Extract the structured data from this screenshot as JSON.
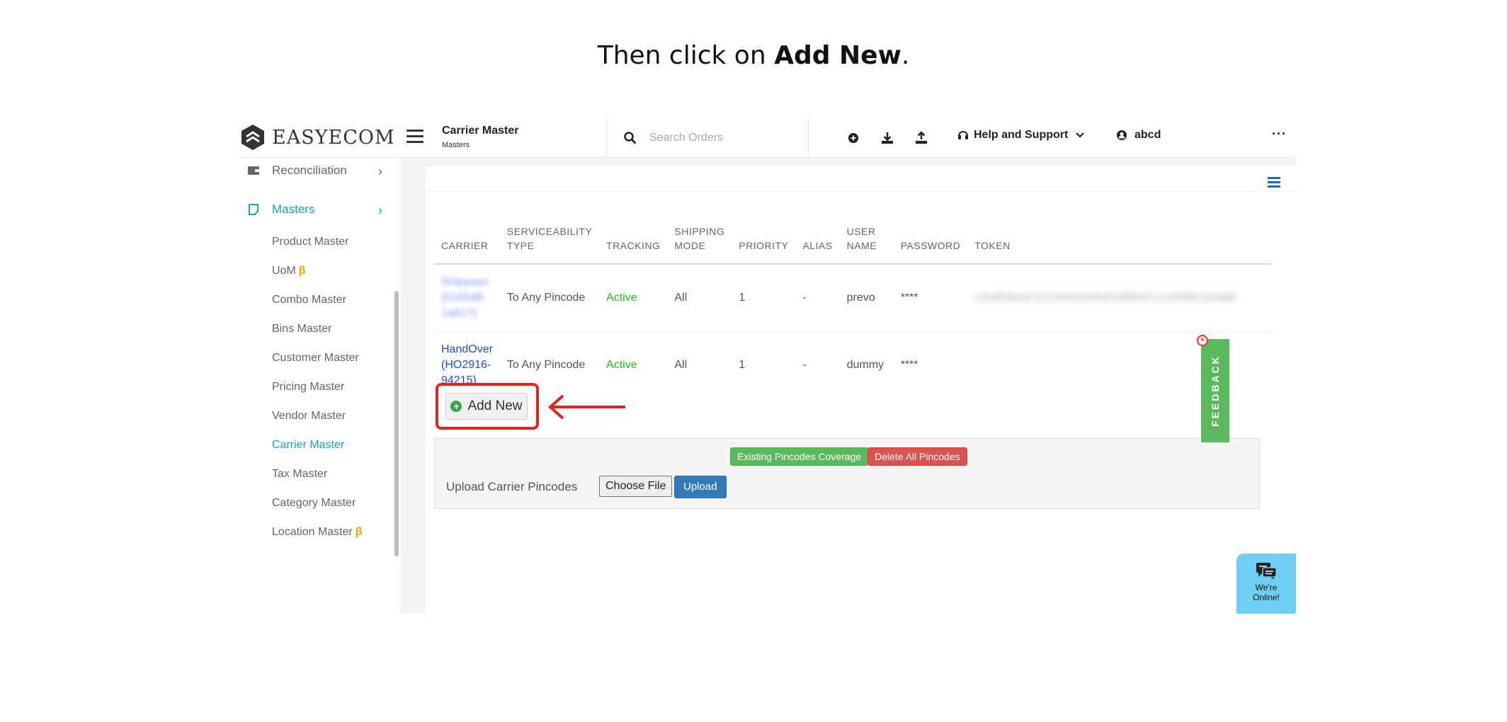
{
  "instruction": {
    "prefix": "Then click on ",
    "bold": "Add New",
    "suffix": "."
  },
  "header": {
    "logo_text": "EASYECOM",
    "page_title": "Carrier Master",
    "page_subtitle": "Masters",
    "search_placeholder": "Search Orders",
    "help_label": "Help and Support",
    "user_name": "abcd",
    "more_label": "···"
  },
  "sidebar": {
    "sections": [
      {
        "label": "Reconciliation",
        "icon": "wallet-icon"
      },
      {
        "label": "Masters",
        "icon": "note-icon"
      }
    ],
    "items": [
      {
        "label": "Product Master",
        "beta": ""
      },
      {
        "label": "UoM",
        "beta": "β"
      },
      {
        "label": "Combo Master",
        "beta": ""
      },
      {
        "label": "Bins Master",
        "beta": ""
      },
      {
        "label": "Customer Master",
        "beta": ""
      },
      {
        "label": "Pricing Master",
        "beta": ""
      },
      {
        "label": "Vendor Master",
        "beta": ""
      },
      {
        "label": "Carrier Master",
        "beta": ""
      },
      {
        "label": "Tax Master",
        "beta": ""
      },
      {
        "label": "Category Master",
        "beta": ""
      },
      {
        "label": "Location Master",
        "beta": "β"
      }
    ],
    "active_item": "Carrier Master"
  },
  "table": {
    "headers": [
      "CARRIER",
      "SERVICEABILITY TYPE",
      "TRACKING",
      "SHIPPING MODE",
      "PRIORITY",
      "ALIAS",
      "USER NAME",
      "PASSWORD",
      "TOKEN"
    ],
    "rows": [
      {
        "carrier": "Shipyaari (0165d8-1a617)",
        "serviceability": "To Any Pincode",
        "tracking": "Active",
        "mode": "All",
        "priority": "1",
        "alias": "-",
        "username": "prevo",
        "password": "****",
        "token": "c4cd53bda7227a9402a0a014f9bd7c1c0f3f6c1bdabf"
      },
      {
        "carrier": "HandOver (HO2916-94215)",
        "serviceability": "To Any Pincode",
        "tracking": "Active",
        "mode": "All",
        "priority": "1",
        "alias": "-",
        "username": "dummy",
        "password": "****",
        "token": ""
      }
    ]
  },
  "actions": {
    "add_new": "Add New",
    "existing_coverage": "Existing Pincodes Coverage",
    "delete_all": "Delete All Pincodes",
    "upload_label": "Upload Carrier Pincodes",
    "choose_file": "Choose File",
    "upload": "Upload"
  },
  "feedback": {
    "label": "FEEDBACK"
  },
  "chat": {
    "line1": "We're",
    "line2": "Online!"
  },
  "colors": {
    "accent": "#1aa3b8",
    "active_status": "#22bb22",
    "carrier_link": "#1a4ed8",
    "highlight": "#e32222"
  }
}
